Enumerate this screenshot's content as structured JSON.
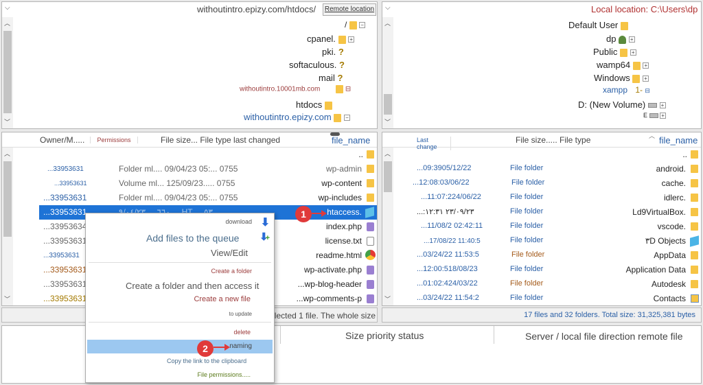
{
  "remote": {
    "address": "withoutintro.epizy.com/htdocs/",
    "location_label": "Remote location",
    "tree": [
      "/",
      "cpanel.",
      "pki.",
      "softaculous.",
      "mail",
      "withoutintro.10001mb.com",
      "htdocs",
      "withoutintro.epizy.com"
    ],
    "columns": {
      "owner": "Owner/M.....",
      "permissions": "Permissions",
      "info": "File size... File type last changed",
      "name": "file_name"
    },
    "rows": [
      {
        "owner": "",
        "info": "",
        "name": ".."
      },
      {
        "owner": "...33953631",
        "info": "Folder ml.... 09/04/23 05:... 0755",
        "name": "wp-admin"
      },
      {
        "owner": "...33953631",
        "info": "Volume ml... 125/09/23..... 0755",
        "name": "wp-content"
      },
      {
        "owner": "...33953631",
        "info": "Folder ml.... 09/04/23 05:... 0755",
        "name": "wp-includes"
      },
      {
        "owner": "...33953631",
        "info": "٦٦٠ ... ٩/٠٤/٢٣ ... HT ... ٥٣",
        "name": "htaccess."
      },
      {
        "owner": "...33953634",
        "info": "",
        "name": "index.php"
      },
      {
        "owner": "...33953631",
        "info": "",
        "name": "license.txt"
      },
      {
        "owner": "...33953631",
        "info": "",
        "name": "readme.html"
      },
      {
        "owner": "...33953631",
        "info": "",
        "name": "wp-activate.php"
      },
      {
        "owner": "...33953631",
        "info": "",
        "name": "...wp-blog-header"
      },
      {
        "owner": "...33953631",
        "info": "",
        "name": "...wp-comments-p"
      }
    ],
    "status": "Selected 1 file. The whole size"
  },
  "local": {
    "address_label": "Local location: C:\\Users\\dp",
    "tree": [
      "Default User",
      "dp",
      "Public",
      "wamp64",
      "Windows",
      "xampp",
      "D: (New Volume)",
      "E"
    ],
    "xampp_prefix": "1-",
    "columns": {
      "last_change": "Last change",
      "info": "File size..... File type",
      "name": "file_name"
    },
    "rows": [
      {
        "date": "",
        "type": "",
        "name": ".."
      },
      {
        "date": "...09:3905/12/22",
        "type": "File folder",
        "name": "android."
      },
      {
        "date": "...12:08:03/06/22",
        "type": "File folder",
        "name": "cache."
      },
      {
        "date": "...11:07:224/06/22",
        "type": "File folder",
        "name": "idlerc."
      },
      {
        "date": "...:۱۲:۳۱ ۲۳/۰۹/۲۳",
        "type": "File folder",
        "name": "Ld9VirtualBox."
      },
      {
        "date": "...11/08/2 02:42:11",
        "type": "File folder",
        "name": "vscode."
      },
      {
        "date": "...17/08/22 11:40:5",
        "type": "File folder",
        "name": "۳D Objects"
      },
      {
        "date": "...03/24/22 11:53:5",
        "type": "File folder",
        "name": "AppData"
      },
      {
        "date": "...12:00:518/08/23",
        "type": "File folder",
        "name": "Application Data"
      },
      {
        "date": "...01:02:424/03/22",
        "type": "File folder",
        "name": "Autodesk"
      },
      {
        "date": "...03/24/22 11:54:2",
        "type": "File folder",
        "name": "Contacts"
      }
    ],
    "status": "17 files and 32 folders. Total size: 31,325,381 bytes"
  },
  "context_menu": {
    "download": "download",
    "add_to_queue": "Add files to the queue",
    "view_edit": "View/Edit",
    "create_folder": "Create a folder",
    "create_folder_access": "Create a folder and then access it",
    "create_file": "Create a new file",
    "to_update": "to update",
    "delete": "delete",
    "naming": "naming",
    "copy_link": "Copy the link to the clipboard",
    "file_permissions": "File permissions....."
  },
  "queue": {
    "col1": "Size priority status",
    "col2": "Server / local file direction remote file"
  },
  "badges": {
    "one": "1",
    "two": "2"
  },
  "colors": {
    "selection": "#1e73d6",
    "menu_highlight": "#9cc8f0",
    "badge": "#e03a3a"
  }
}
